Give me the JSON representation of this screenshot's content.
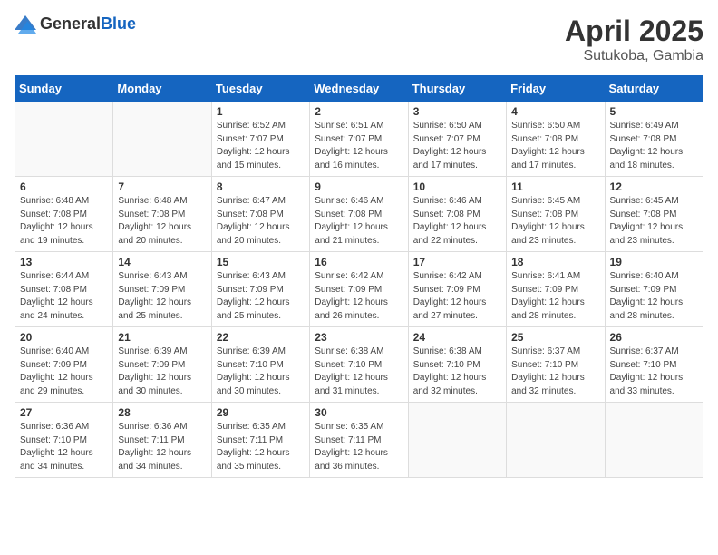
{
  "header": {
    "logo_general": "General",
    "logo_blue": "Blue",
    "month": "April 2025",
    "location": "Sutukoba, Gambia"
  },
  "weekdays": [
    "Sunday",
    "Monday",
    "Tuesday",
    "Wednesday",
    "Thursday",
    "Friday",
    "Saturday"
  ],
  "weeks": [
    [
      {
        "day": "",
        "info": ""
      },
      {
        "day": "",
        "info": ""
      },
      {
        "day": "1",
        "info": "Sunrise: 6:52 AM\nSunset: 7:07 PM\nDaylight: 12 hours and 15 minutes."
      },
      {
        "day": "2",
        "info": "Sunrise: 6:51 AM\nSunset: 7:07 PM\nDaylight: 12 hours and 16 minutes."
      },
      {
        "day": "3",
        "info": "Sunrise: 6:50 AM\nSunset: 7:07 PM\nDaylight: 12 hours and 17 minutes."
      },
      {
        "day": "4",
        "info": "Sunrise: 6:50 AM\nSunset: 7:08 PM\nDaylight: 12 hours and 17 minutes."
      },
      {
        "day": "5",
        "info": "Sunrise: 6:49 AM\nSunset: 7:08 PM\nDaylight: 12 hours and 18 minutes."
      }
    ],
    [
      {
        "day": "6",
        "info": "Sunrise: 6:48 AM\nSunset: 7:08 PM\nDaylight: 12 hours and 19 minutes."
      },
      {
        "day": "7",
        "info": "Sunrise: 6:48 AM\nSunset: 7:08 PM\nDaylight: 12 hours and 20 minutes."
      },
      {
        "day": "8",
        "info": "Sunrise: 6:47 AM\nSunset: 7:08 PM\nDaylight: 12 hours and 20 minutes."
      },
      {
        "day": "9",
        "info": "Sunrise: 6:46 AM\nSunset: 7:08 PM\nDaylight: 12 hours and 21 minutes."
      },
      {
        "day": "10",
        "info": "Sunrise: 6:46 AM\nSunset: 7:08 PM\nDaylight: 12 hours and 22 minutes."
      },
      {
        "day": "11",
        "info": "Sunrise: 6:45 AM\nSunset: 7:08 PM\nDaylight: 12 hours and 23 minutes."
      },
      {
        "day": "12",
        "info": "Sunrise: 6:45 AM\nSunset: 7:08 PM\nDaylight: 12 hours and 23 minutes."
      }
    ],
    [
      {
        "day": "13",
        "info": "Sunrise: 6:44 AM\nSunset: 7:08 PM\nDaylight: 12 hours and 24 minutes."
      },
      {
        "day": "14",
        "info": "Sunrise: 6:43 AM\nSunset: 7:09 PM\nDaylight: 12 hours and 25 minutes."
      },
      {
        "day": "15",
        "info": "Sunrise: 6:43 AM\nSunset: 7:09 PM\nDaylight: 12 hours and 25 minutes."
      },
      {
        "day": "16",
        "info": "Sunrise: 6:42 AM\nSunset: 7:09 PM\nDaylight: 12 hours and 26 minutes."
      },
      {
        "day": "17",
        "info": "Sunrise: 6:42 AM\nSunset: 7:09 PM\nDaylight: 12 hours and 27 minutes."
      },
      {
        "day": "18",
        "info": "Sunrise: 6:41 AM\nSunset: 7:09 PM\nDaylight: 12 hours and 28 minutes."
      },
      {
        "day": "19",
        "info": "Sunrise: 6:40 AM\nSunset: 7:09 PM\nDaylight: 12 hours and 28 minutes."
      }
    ],
    [
      {
        "day": "20",
        "info": "Sunrise: 6:40 AM\nSunset: 7:09 PM\nDaylight: 12 hours and 29 minutes."
      },
      {
        "day": "21",
        "info": "Sunrise: 6:39 AM\nSunset: 7:09 PM\nDaylight: 12 hours and 30 minutes."
      },
      {
        "day": "22",
        "info": "Sunrise: 6:39 AM\nSunset: 7:10 PM\nDaylight: 12 hours and 30 minutes."
      },
      {
        "day": "23",
        "info": "Sunrise: 6:38 AM\nSunset: 7:10 PM\nDaylight: 12 hours and 31 minutes."
      },
      {
        "day": "24",
        "info": "Sunrise: 6:38 AM\nSunset: 7:10 PM\nDaylight: 12 hours and 32 minutes."
      },
      {
        "day": "25",
        "info": "Sunrise: 6:37 AM\nSunset: 7:10 PM\nDaylight: 12 hours and 32 minutes."
      },
      {
        "day": "26",
        "info": "Sunrise: 6:37 AM\nSunset: 7:10 PM\nDaylight: 12 hours and 33 minutes."
      }
    ],
    [
      {
        "day": "27",
        "info": "Sunrise: 6:36 AM\nSunset: 7:10 PM\nDaylight: 12 hours and 34 minutes."
      },
      {
        "day": "28",
        "info": "Sunrise: 6:36 AM\nSunset: 7:11 PM\nDaylight: 12 hours and 34 minutes."
      },
      {
        "day": "29",
        "info": "Sunrise: 6:35 AM\nSunset: 7:11 PM\nDaylight: 12 hours and 35 minutes."
      },
      {
        "day": "30",
        "info": "Sunrise: 6:35 AM\nSunset: 7:11 PM\nDaylight: 12 hours and 36 minutes."
      },
      {
        "day": "",
        "info": ""
      },
      {
        "day": "",
        "info": ""
      },
      {
        "day": "",
        "info": ""
      }
    ]
  ]
}
